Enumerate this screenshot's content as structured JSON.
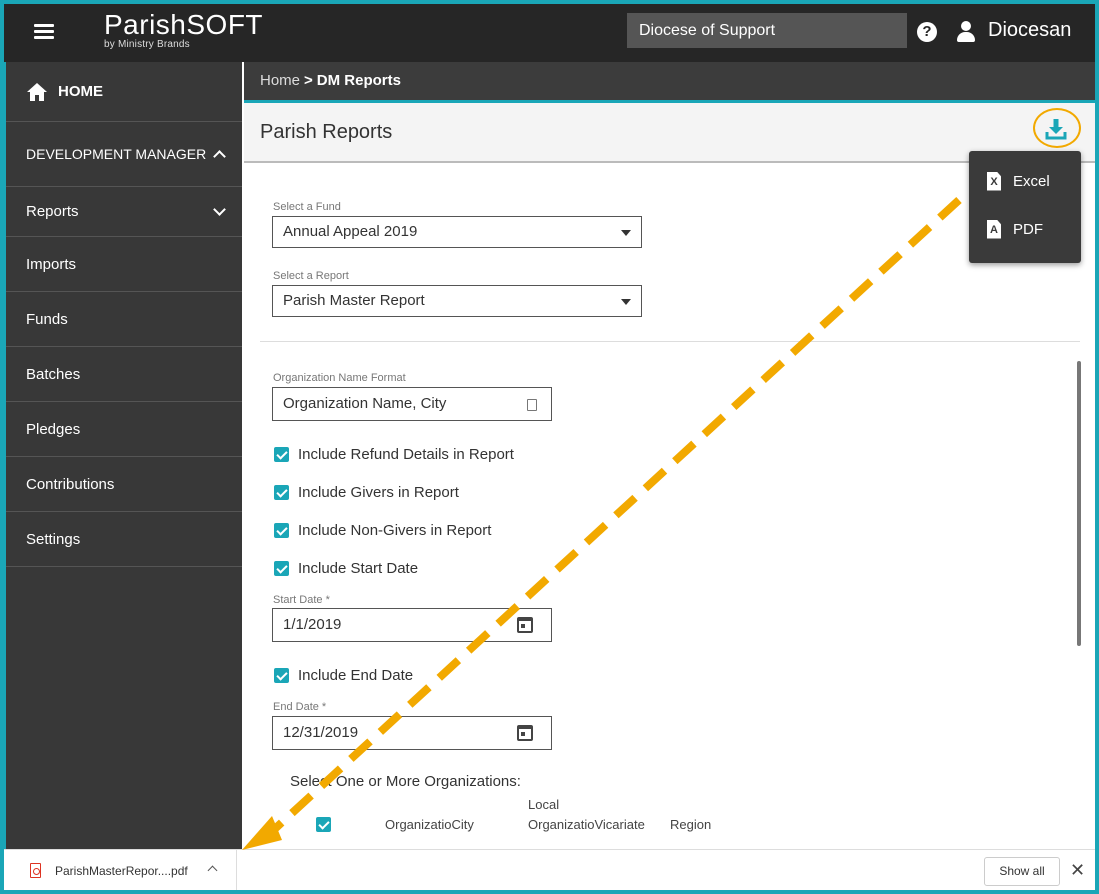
{
  "topbar": {
    "logo_main": "ParishSOFT",
    "logo_sub": "by Ministry Brands",
    "diocese": "Diocese of Support",
    "help_glyph": "?",
    "user_name": "Diocesan"
  },
  "sidebar": {
    "home": "HOME",
    "section": "DEVELOPMENT MANAGER",
    "items": [
      {
        "label": "Reports",
        "icon": "chevron-down-icon"
      },
      {
        "label": "Imports"
      },
      {
        "label": "Funds"
      },
      {
        "label": "Batches"
      },
      {
        "label": "Pledges"
      },
      {
        "label": "Contributions"
      },
      {
        "label": "Settings"
      }
    ]
  },
  "breadcrumb": {
    "home": "Home",
    "separator": ">",
    "current": "DM Reports"
  },
  "page": {
    "title": "Parish Reports"
  },
  "export_menu": {
    "items": [
      {
        "label": "Excel",
        "icon_glyph": "X"
      },
      {
        "label": "PDF",
        "icon_glyph": "A"
      }
    ]
  },
  "form": {
    "fund_label": "Select a Fund",
    "fund_value": "Annual Appeal 2019",
    "report_label": "Select a Report",
    "report_value": "Parish Master Report",
    "org_format_label": "Organization Name Format",
    "org_format_value": "Organization Name, City",
    "checks": [
      {
        "label": "Include Refund Details in Report",
        "checked": true
      },
      {
        "label": "Include Givers in Report",
        "checked": true
      },
      {
        "label": "Include Non-Givers in Report",
        "checked": true
      },
      {
        "label": "Include Start Date",
        "checked": true
      }
    ],
    "start_date_label": "Start Date *",
    "start_date_value": "1/1/2019",
    "end_check_label": "Include End Date",
    "end_date_label": "End Date *",
    "end_date_value": "12/31/2019",
    "org_select_title": "Select One or More Organizations:",
    "columns": {
      "col1": "OrganizatioCity",
      "col2_line1": "Local",
      "col2_line2": "OrganizatioVicariate",
      "col3": "Region"
    }
  },
  "download_bar": {
    "file_name": "ParishMasterRepor....pdf",
    "show_all": "Show all",
    "close_glyph": "✕"
  },
  "colors": {
    "accent": "#1aa6b7",
    "highlight": "#f2a900",
    "topbar": "#262626",
    "sidebar": "#383838"
  }
}
